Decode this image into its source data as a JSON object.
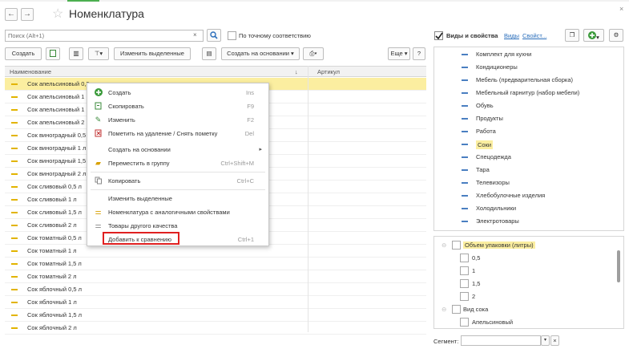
{
  "window": {
    "title": "Номенклатура",
    "back": "←",
    "forward": "→",
    "close": "×"
  },
  "search": {
    "placeholder": "Поиск (Alt+1)",
    "clear": "×",
    "exact_match_label": "По точному соответствию"
  },
  "toolbar": {
    "create": "Создать",
    "edit_selected": "Изменить выделенные",
    "create_based_on": "Создать на основании",
    "more": "Еще",
    "help": "?"
  },
  "table": {
    "columns": {
      "name": "Наименование",
      "article": "Артикул",
      "sort_arrow": "↓"
    },
    "rows": [
      "Сок апельсиновый 0,5",
      "Сок апельсиновый 1",
      "Сок апельсиновый 1",
      "Сок апельсиновый 2",
      "Сок виноградный 0,5",
      "Сок виноградный 1 л",
      "Сок виноградный 1,5",
      "Сок виноградный 2 л",
      "Сок сливовый 0,5 л",
      "Сок сливовый 1 л",
      "Сок сливовый 1,5 л",
      "Сок сливовый 2 л",
      "Сок томатный 0,5 л",
      "Сок томатный 1 л",
      "Сок томатный 1,5 л",
      "Сок томатный 2 л",
      "Сок яблочный 0,5 л",
      "Сок яблочный 1 л",
      "Сок яблочный 1,5 л",
      "Сок яблочный 2 л"
    ]
  },
  "context_menu": {
    "items": [
      {
        "label": "Создать",
        "shortcut": "Ins"
      },
      {
        "label": "Скопировать",
        "shortcut": "F9"
      },
      {
        "label": "Изменить",
        "shortcut": "F2"
      },
      {
        "label": "Пометить на удаление / Снять пометку",
        "shortcut": "Del"
      },
      {
        "label": "Создать на основании",
        "shortcut": ""
      },
      {
        "label": "Переместить в группу",
        "shortcut": "Ctrl+Shift+M"
      },
      {
        "label": "Копировать",
        "shortcut": "Ctrl+C"
      },
      {
        "label": "Изменить выделенные",
        "shortcut": ""
      },
      {
        "label": "Номенклатура с аналогичными свойствами",
        "shortcut": ""
      },
      {
        "label": "Товары другого качества",
        "shortcut": ""
      },
      {
        "label": "Добавить к сравнению",
        "shortcut": "Ctrl+1"
      }
    ],
    "submenu_arrow": "▸"
  },
  "right_panel": {
    "header_label": "Виды и свойства",
    "link_views": "Виды",
    "link_props": "Свойст...",
    "categories": [
      "Комплект для кухни",
      "Кондиционеры",
      "Мебель (предварительная сборка)",
      "Мебельный гарнитур (набор мебели)",
      "Обувь",
      "Продукты",
      "Работа",
      "Соки",
      "Спецодежда",
      "Тара",
      "Телевизоры",
      "Хлебобулочные изделия",
      "Холодильники",
      "Электротовары"
    ],
    "property_groups": {
      "volume": "Объем упаковки (литры)",
      "volume_values": [
        "0,5",
        "1",
        "1,5",
        "2"
      ],
      "juice_type": "Вид сока",
      "juice_values": [
        "Апельсиновый"
      ]
    },
    "segment_label": "Сегмент:",
    "segment_clear": "×"
  },
  "colors": {
    "selection": "#fbeea0",
    "highlight_border": "#e02020",
    "accent_green": "#4caf50",
    "link": "#2a6ebb"
  }
}
